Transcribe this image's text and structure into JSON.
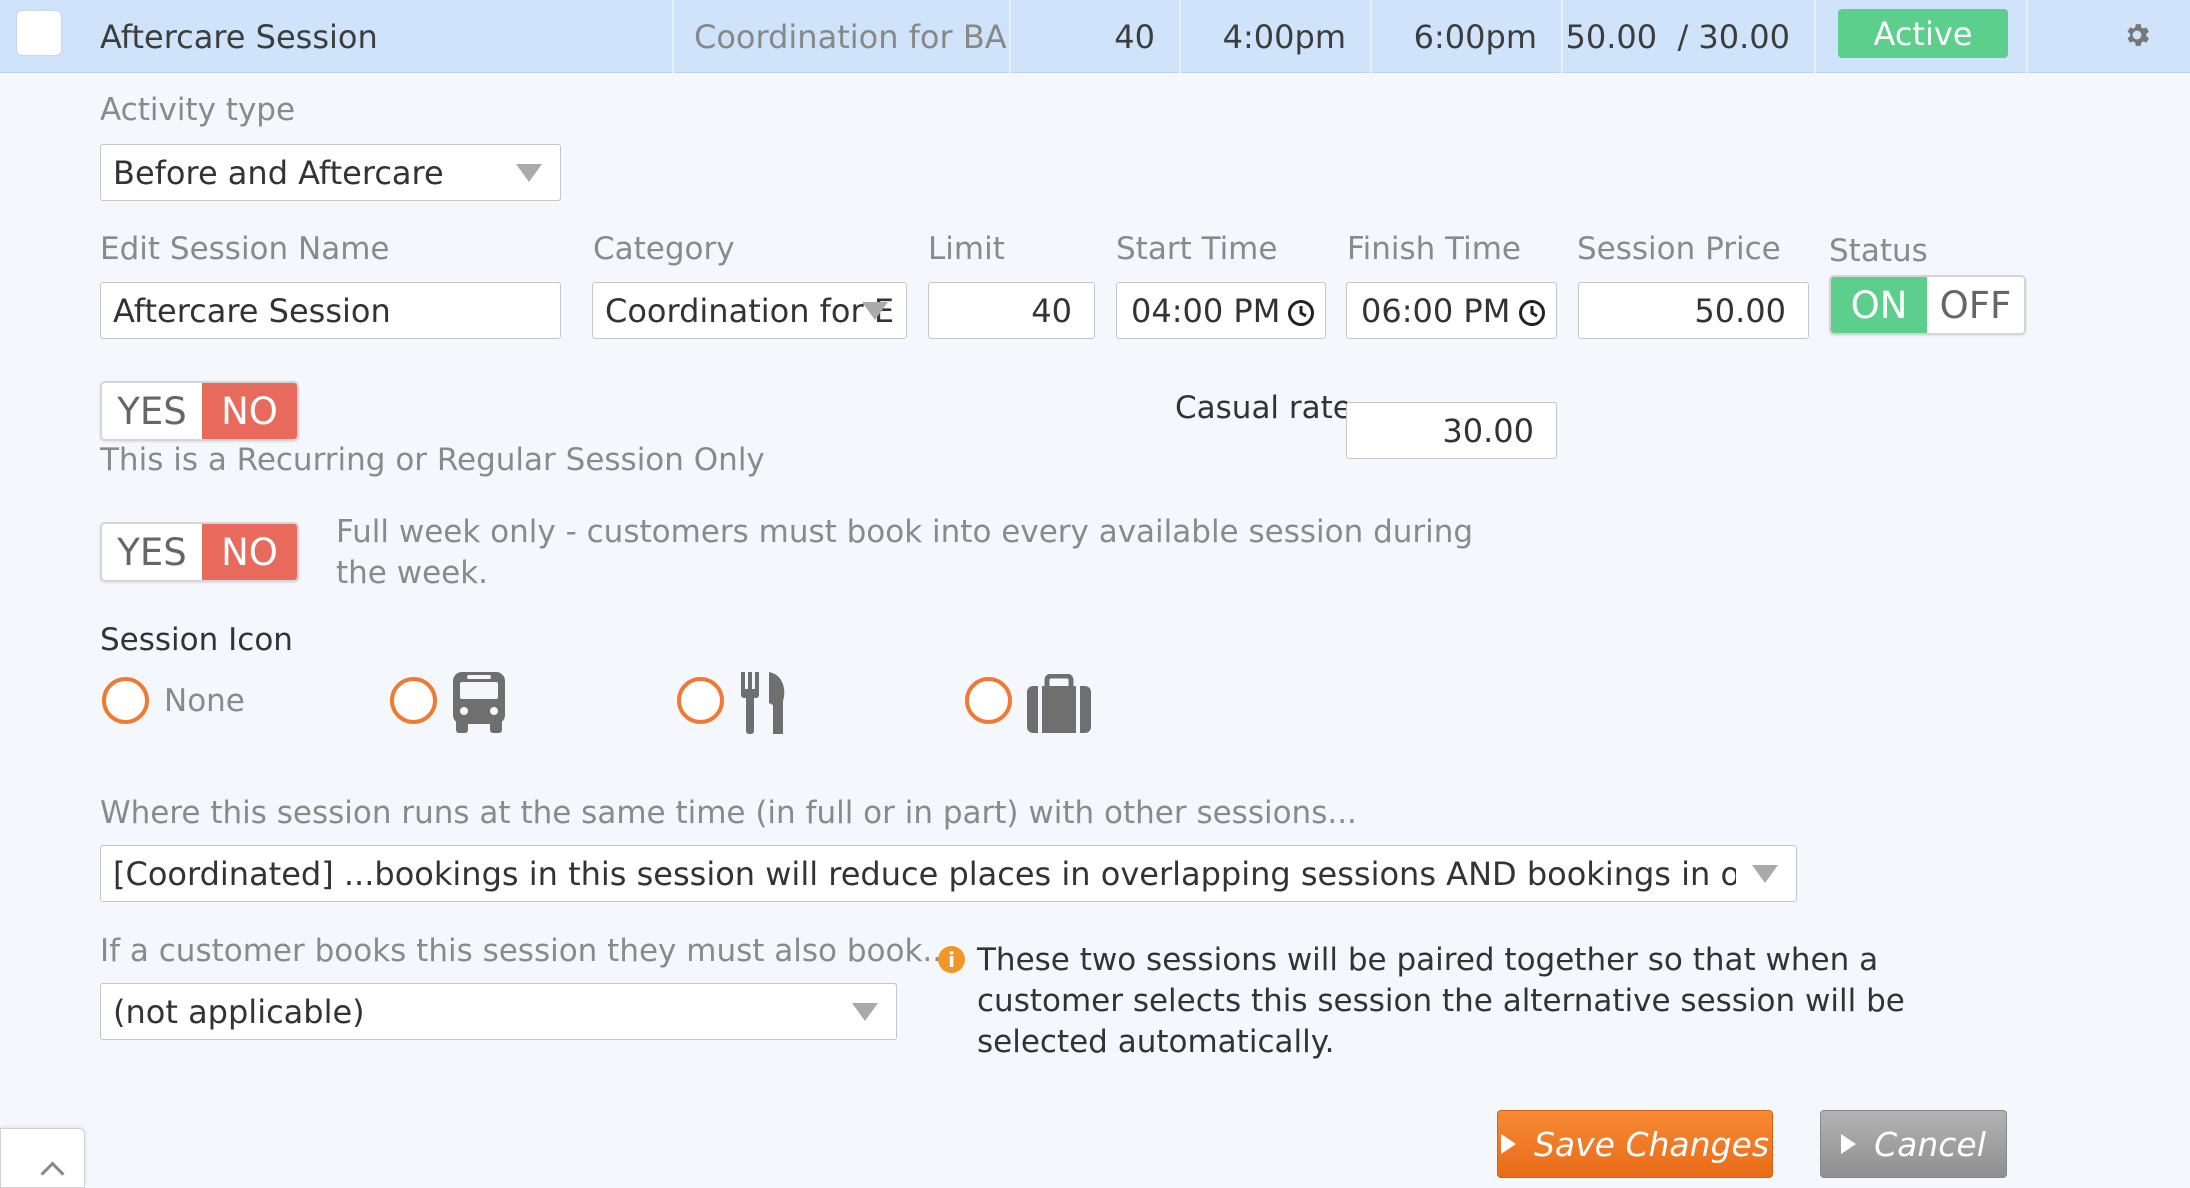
{
  "header": {
    "session_name": "Aftercare Session",
    "category": "Coordination for BA...",
    "limit": "40",
    "start": "4:00pm",
    "finish": "6:00pm",
    "prices": "50.00  / 30.00",
    "status_badge": "Active",
    "status_color": "#5ccf8c"
  },
  "form": {
    "activity_type_label": "Activity type",
    "activity_type_value": "Before and Aftercare",
    "session_name_label": "Edit Session Name",
    "session_name_value": "Aftercare Session",
    "category_label": "Category",
    "category_value": "Coordination for E",
    "limit_label": "Limit",
    "limit_value": "40",
    "start_label": "Start Time",
    "start_value": "04:00 PM",
    "finish_label": "Finish Time",
    "finish_value": "06:00 PM",
    "price_label": "Session Price",
    "price_value": "50.00",
    "status_label": "Status",
    "status_on": "ON",
    "status_off": "OFF",
    "recurring_yes": "YES",
    "recurring_no": "NO",
    "recurring_help": "This is a Recurring or Regular Session Only",
    "casual_label": "Casual rate:",
    "casual_value": "30.00",
    "fullweek_yes": "YES",
    "fullweek_no": "NO",
    "fullweek_help_line1": "Full week only - customers must book into every available session during",
    "fullweek_help_line2": "the week.",
    "icon_label": "Session Icon",
    "icon_none": "None",
    "overlap_label": "Where this session runs at the same time (in full or in part) with other sessions...",
    "overlap_value": "[Coordinated] ...bookings in this session will reduce places in overlapping sessions AND bookings in overlapping sessions w",
    "pair_label": "If a customer books this session they must also book...",
    "pair_value": "(not applicable)",
    "pair_info_line1": "These two sessions will be paired together so that when a",
    "pair_info_line2": "customer selects this session the alternative session will be",
    "pair_info_line3": "selected automatically.",
    "save_label": "Save Changes",
    "cancel_label": "Cancel"
  },
  "colors": {
    "header_bg": "#cfe4fb",
    "toggle_no": "#e86a5c",
    "toggle_on": "#5ccf8c",
    "radio": "#ee7b33",
    "save": "#f07d25",
    "cancel": "#a0a0a0"
  },
  "icons": [
    "radio-none",
    "bus-icon",
    "fork-knife-icon",
    "briefcase-icon",
    "clock-icon",
    "gear-icon",
    "info-icon",
    "chevron-down-icon",
    "chevron-up-icon"
  ]
}
